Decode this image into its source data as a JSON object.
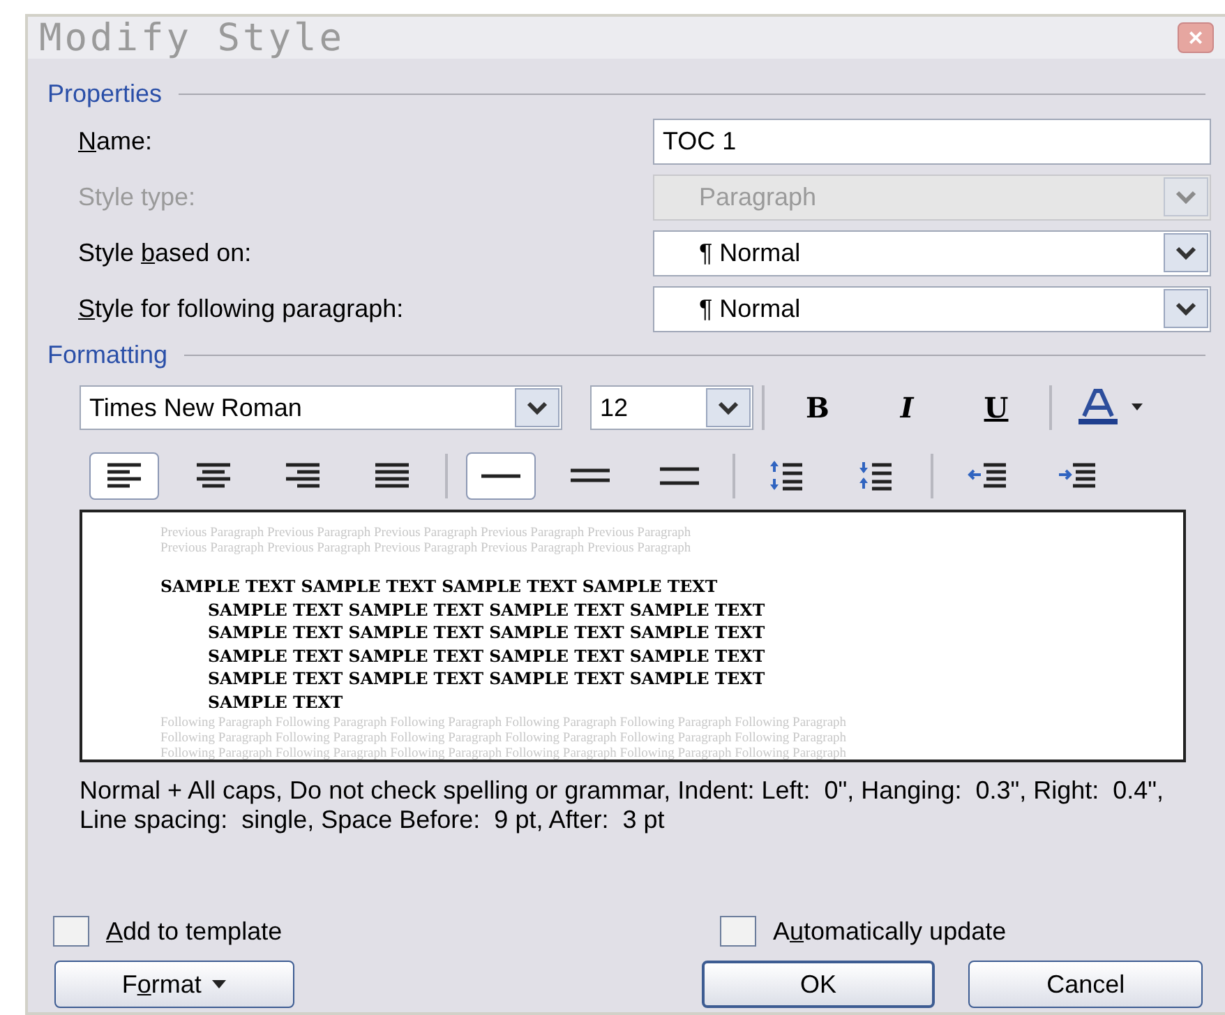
{
  "window": {
    "title": "Modify Style",
    "close": "×"
  },
  "properties": {
    "legend": "Properties",
    "rows": [
      {
        "label_parts": {
          "key": "N",
          "after": "ame:"
        },
        "kind": "text",
        "value": "TOC 1",
        "disabled": false
      },
      {
        "label_parts": {
          "before": "Style type:"
        },
        "kind": "select",
        "value": "Paragraph",
        "disabled": true
      },
      {
        "label_parts": {
          "before": "Style ",
          "key": "b",
          "after": "ased on:"
        },
        "kind": "select",
        "value": "¶ Normal",
        "disabled": false
      },
      {
        "label_parts": {
          "key": "S",
          "after": "tyle for following paragraph:"
        },
        "kind": "select",
        "value": "¶ Normal",
        "disabled": false
      }
    ]
  },
  "formatting": {
    "legend": "Formatting",
    "font": "Times New Roman",
    "size": "12",
    "style_buttons": [
      {
        "label": "B",
        "kind": "bold"
      },
      {
        "label": "I",
        "kind": "italic"
      },
      {
        "label": "U",
        "kind": "underline"
      }
    ],
    "tools": [
      {
        "kind": "align-left",
        "selected": true
      },
      {
        "kind": "align-center",
        "selected": false
      },
      {
        "kind": "align-right",
        "selected": false
      },
      {
        "kind": "justify",
        "selected": false
      },
      {
        "kind": "sep"
      },
      {
        "kind": "single",
        "selected": true
      },
      {
        "kind": "onehalf",
        "selected": false
      },
      {
        "kind": "double",
        "selected": false
      },
      {
        "kind": "sep"
      },
      {
        "kind": "space-up",
        "selected": false
      },
      {
        "kind": "space-down",
        "selected": false
      },
      {
        "kind": "sep"
      },
      {
        "kind": "outdent",
        "selected": false
      },
      {
        "kind": "indent",
        "selected": false
      }
    ],
    "preview": {
      "previous": [
        "Previous Paragraph Previous Paragraph Previous Paragraph Previous Paragraph Previous Paragraph",
        "Previous Paragraph Previous Paragraph Previous Paragraph Previous Paragraph Previous Paragraph"
      ],
      "sample_first": "SAMPLE TEXT SAMPLE TEXT SAMPLE TEXT SAMPLE TEXT",
      "sample_rest": [
        "SAMPLE TEXT SAMPLE TEXT SAMPLE TEXT SAMPLE TEXT",
        "SAMPLE TEXT SAMPLE TEXT SAMPLE TEXT SAMPLE TEXT",
        "SAMPLE TEXT SAMPLE TEXT SAMPLE TEXT SAMPLE TEXT",
        "SAMPLE TEXT SAMPLE TEXT SAMPLE TEXT SAMPLE TEXT",
        "SAMPLE TEXT"
      ],
      "following": [
        "Following Paragraph Following Paragraph Following Paragraph Following Paragraph Following Paragraph Following Paragraph",
        "Following Paragraph Following Paragraph Following Paragraph Following Paragraph Following Paragraph Following Paragraph",
        "Following Paragraph Following Paragraph Following Paragraph Following Paragraph Following Paragraph Following Paragraph"
      ]
    },
    "description": "Normal + All caps, Do not check spelling or grammar, Indent: Left:  0\", Hanging:  0.3\", Right:  0.4\", Line spacing:  single, Space Before:  9 pt, After:  3 pt"
  },
  "options": [
    {
      "label_parts": {
        "key": "A",
        "after": "dd to template"
      },
      "checked": false
    },
    {
      "label_parts": {
        "before": "A",
        "key": "u",
        "after": "tomatically update"
      },
      "checked": false
    }
  ],
  "buttons": [
    {
      "label_parts": {
        "before": "F",
        "key": "o",
        "after": "rmat"
      },
      "kind": "menu"
    },
    {
      "label_parts": {
        "before": "OK"
      },
      "kind": "default"
    },
    {
      "label_parts": {
        "before": "Cancel"
      },
      "kind": "plain"
    }
  ]
}
